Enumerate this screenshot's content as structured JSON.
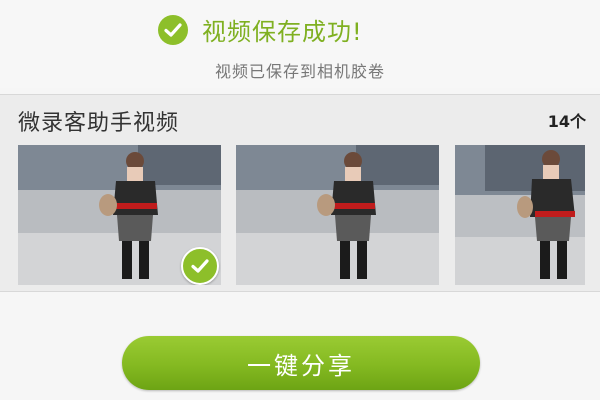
{
  "header": {
    "title": "视频保存成功!",
    "subtitle": "视频已保存到相机胶卷",
    "icon": "check-circle-icon"
  },
  "section": {
    "title": "微录客助手视频",
    "count": "14个"
  },
  "thumbnails": [
    {
      "selected": true
    },
    {
      "selected": false
    },
    {
      "selected": false
    }
  ],
  "share_button": {
    "label": "一键分享"
  },
  "colors": {
    "accent": "#8dbf2a",
    "title_green": "#7fb021",
    "background": "#f6f6f6",
    "section_bg": "#ececec"
  }
}
